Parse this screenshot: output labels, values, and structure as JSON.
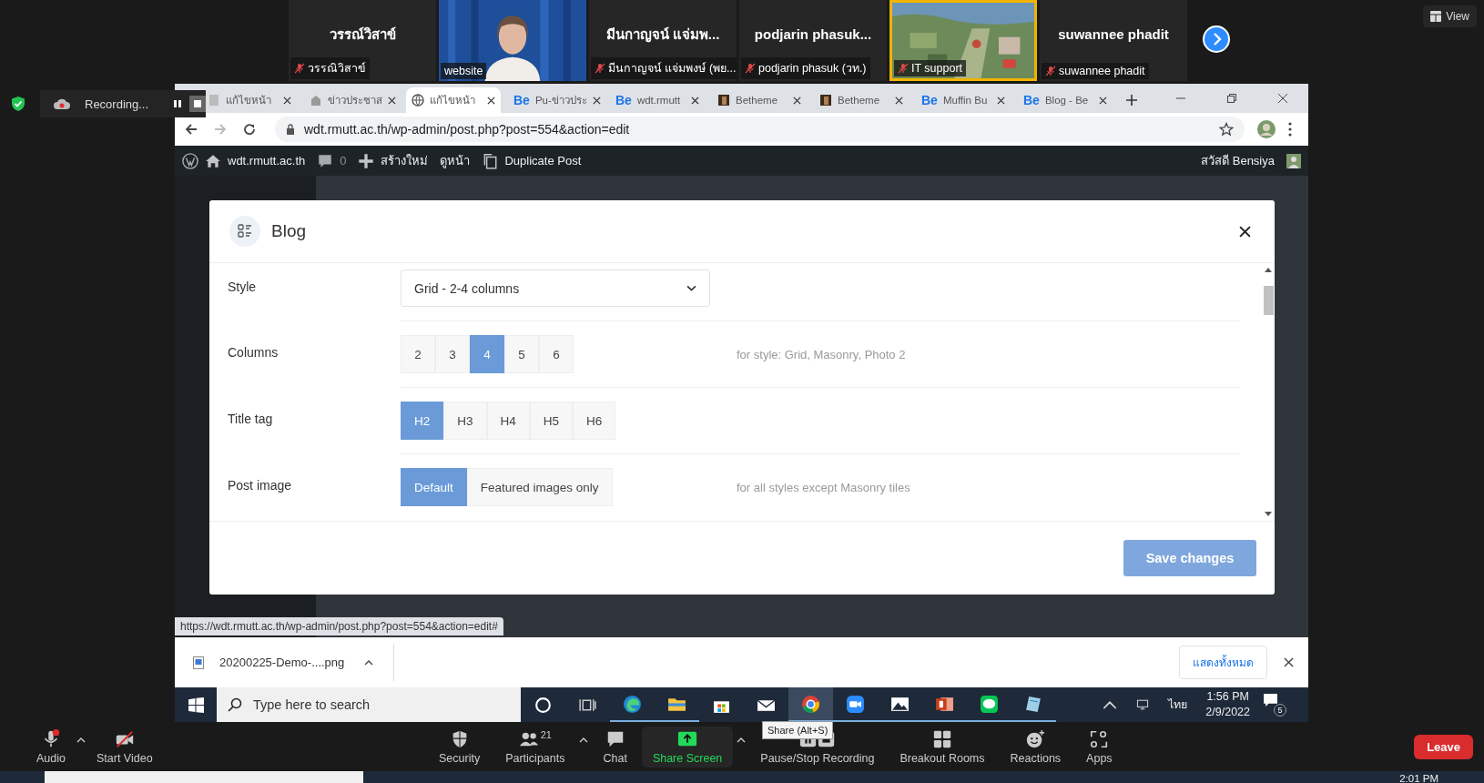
{
  "participants": [
    {
      "kind": "name",
      "name": "วรรณ์วิสาข์",
      "label": "วรรณิวิสาข์",
      "muted": true,
      "highlighted": false
    },
    {
      "kind": "video",
      "label": "website",
      "muted": false,
      "highlighted": false
    },
    {
      "kind": "name",
      "name": "มีนกาญจน์ แจ่มพ...",
      "label": "มีนกาญจน์ แจ่มพงษ์ (พย...",
      "muted": true,
      "highlighted": false
    },
    {
      "kind": "name",
      "name": "podjarin  phasuk...",
      "label": "podjarin phasuk (วท.)",
      "muted": true,
      "highlighted": false
    },
    {
      "kind": "picture",
      "label": "IT support",
      "muted": true,
      "highlighted": true
    },
    {
      "kind": "name",
      "name": "suwannee phadit",
      "label": "suwannee phadit",
      "muted": true,
      "highlighted": false
    }
  ],
  "view_button": "View",
  "recording": "Recording...",
  "browser": {
    "tabs": [
      {
        "title": "แก้ไขหน้า",
        "kind": "page",
        "selected": false
      },
      {
        "title": "ข่าวประชาส",
        "kind": "org",
        "selected": false
      },
      {
        "title": "แก้ไขหน้า",
        "kind": "globe",
        "selected": true
      },
      {
        "title": "Pu-ข่าวประ",
        "kind": "be",
        "badge": "Be",
        "selected": false
      },
      {
        "title": "wdt.rmutt",
        "kind": "be",
        "badge": "Be",
        "selected": false
      },
      {
        "title": "Betheme",
        "kind": "thumb",
        "selected": false
      },
      {
        "title": "Betheme",
        "kind": "thumb",
        "selected": false
      },
      {
        "title": "Muffin Bu",
        "kind": "be",
        "badge": "Be",
        "selected": false
      },
      {
        "title": "Blog - Be",
        "kind": "be",
        "badge": "Be",
        "selected": false
      }
    ],
    "url": "wdt.rmutt.ac.th/wp-admin/post.php?post=554&action=edit"
  },
  "admin_bar": {
    "site": "wdt.rmutt.ac.th",
    "comments": "0",
    "new": "สร้างใหม่",
    "view": "ดูหน้า",
    "duplicate": "Duplicate Post",
    "greeting": "สวัสดี Bensiya"
  },
  "modal": {
    "title": "Blog",
    "fields": [
      {
        "kind": "select",
        "label": "Style",
        "value": "Grid - 2-4 columns"
      },
      {
        "kind": "segments",
        "label": "Columns",
        "options": [
          {
            "label": "2",
            "selected": false
          },
          {
            "label": "3",
            "selected": false
          },
          {
            "label": "4",
            "selected": true
          },
          {
            "label": "5",
            "selected": false
          },
          {
            "label": "6",
            "selected": false
          }
        ],
        "hint": "for style: Grid, Masonry, Photo 2"
      },
      {
        "kind": "segments",
        "label": "Title tag",
        "options": [
          {
            "label": "H2",
            "selected": true
          },
          {
            "label": "H3",
            "selected": false
          },
          {
            "label": "H4",
            "selected": false
          },
          {
            "label": "H5",
            "selected": false
          },
          {
            "label": "H6",
            "selected": false
          }
        ]
      },
      {
        "kind": "segments",
        "label": "Post image",
        "options": [
          {
            "label": "Default",
            "selected": true
          },
          {
            "label": "Featured images only",
            "selected": false
          }
        ],
        "hint": "for all styles except Masonry tiles"
      }
    ],
    "save": "Save changes"
  },
  "status_url": "https://wdt.rmutt.ac.th/wp-admin/post.php?post=554&action=edit#",
  "download": {
    "file": "20200225-Demo-....png",
    "show_all": "แสดงทั้งหมด"
  },
  "taskbar": {
    "search_placeholder": "Type here to search",
    "apps": [
      {
        "kind": "cortana",
        "running": false,
        "active": false
      },
      {
        "kind": "taskview",
        "running": false,
        "active": false
      },
      {
        "kind": "edge",
        "running": true,
        "active": false
      },
      {
        "kind": "explorer",
        "running": true,
        "active": false
      },
      {
        "kind": "store",
        "running": false,
        "active": false
      },
      {
        "kind": "mail",
        "running": false,
        "active": false
      },
      {
        "kind": "chrome",
        "running": true,
        "active": true
      },
      {
        "kind": "zoom",
        "running": true,
        "active": false
      },
      {
        "kind": "photos",
        "running": true,
        "active": false
      },
      {
        "kind": "powerpoint",
        "running": true,
        "active": false
      },
      {
        "kind": "line",
        "running": true,
        "active": false
      },
      {
        "kind": "notes",
        "running": true,
        "active": false
      }
    ],
    "language": "ไทย",
    "time": "1:56 PM",
    "date": "2/9/2022",
    "notifications": "5"
  },
  "toolbar": {
    "left": [
      {
        "kind": "audio",
        "label": "Audio",
        "caret": true
      },
      {
        "kind": "video",
        "label": "Start Video",
        "caret": false
      }
    ],
    "center": [
      {
        "kind": "security",
        "label": "Security",
        "caret": false
      },
      {
        "kind": "participants",
        "label": "Participants",
        "count": "21",
        "caret": true
      },
      {
        "kind": "chat",
        "label": "Chat",
        "caret": false
      },
      {
        "kind": "share",
        "label": "Share Screen",
        "caret": true
      },
      {
        "kind": "record",
        "label": "Pause/Stop Recording",
        "caret": false
      },
      {
        "kind": "breakout",
        "label": "Breakout Rooms",
        "caret": false
      },
      {
        "kind": "reactions",
        "label": "Reactions",
        "caret": false
      },
      {
        "kind": "apps",
        "label": "Apps",
        "caret": false
      }
    ],
    "tooltip": "Share (Alt+S)",
    "leave": "Leave"
  },
  "bottom_clock": "2:01 PM"
}
